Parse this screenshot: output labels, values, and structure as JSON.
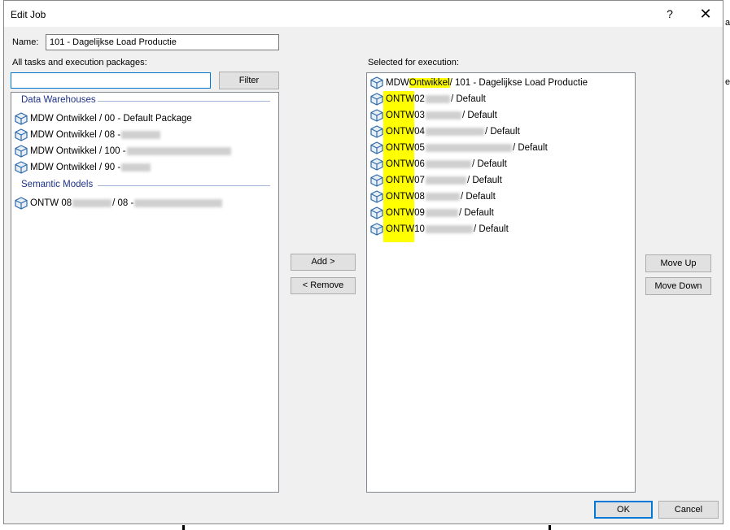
{
  "dialog": {
    "title": "Edit Job",
    "help_label": "?",
    "close_label": "✕"
  },
  "name_field": {
    "label": "Name:",
    "value": "101 - Dagelijkse Load Productie"
  },
  "left_panel": {
    "label": "All tasks and execution packages:",
    "search_value": "",
    "filter_button": "Filter",
    "groups": [
      {
        "header": "Data Warehouses",
        "items": [
          {
            "prefix": "MDW Ontwikkel / 00 - Default Package",
            "suffix": ""
          },
          {
            "prefix": "MDW Ontwikkel / 08 - ",
            "suffix": ""
          },
          {
            "prefix": "MDW Ontwikkel / 100 - ",
            "suffix": ""
          },
          {
            "prefix": "MDW Ontwikkel / 90 - ",
            "suffix": ""
          }
        ]
      },
      {
        "header": "Semantic Models",
        "items": [
          {
            "prefix": "ONTW 08 ",
            "mid": " / 08 - ",
            "suffix": ""
          }
        ]
      }
    ]
  },
  "middle_buttons": {
    "add": "Add >",
    "remove": "< Remove"
  },
  "right_panel": {
    "label": "Selected for execution:",
    "first": {
      "pre": "MDW ",
      "hl": "Ontwikkel",
      "post": " / 101 - Dagelijkse Load Productie"
    },
    "items": [
      {
        "hl": "ONTW",
        "num": " 02 ",
        "post": " / Default"
      },
      {
        "hl": "ONTW",
        "num": " 03 ",
        "post": " / Default"
      },
      {
        "hl": "ONTW",
        "num": " 04 ",
        "post": " / Default"
      },
      {
        "hl": "ONTW",
        "num": " 05 ",
        "post": " / Default"
      },
      {
        "hl": "ONTW",
        "num": " 06 ",
        "post": " / Default"
      },
      {
        "hl": "ONTW",
        "num": " 07 ",
        "post": " / Default"
      },
      {
        "hl": "ONTW",
        "num": " 08 ",
        "post": " / Default"
      },
      {
        "hl": "ONTW",
        "num": " 09 ",
        "post": " / Default"
      },
      {
        "hl": "ONTW",
        "num": " 10 ",
        "post": " / Default"
      }
    ]
  },
  "order_buttons": {
    "move_up": "Move Up",
    "move_down": "Move Down"
  },
  "footer": {
    "ok": "OK",
    "cancel": "Cancel"
  },
  "background": {
    "frag1": "a",
    "frag2": "e"
  },
  "icons": {
    "package": "package-cube-icon"
  },
  "colors": {
    "highlight": "#ffff00",
    "group_header": "#1e3287",
    "default_button_border": "#0078d7"
  }
}
